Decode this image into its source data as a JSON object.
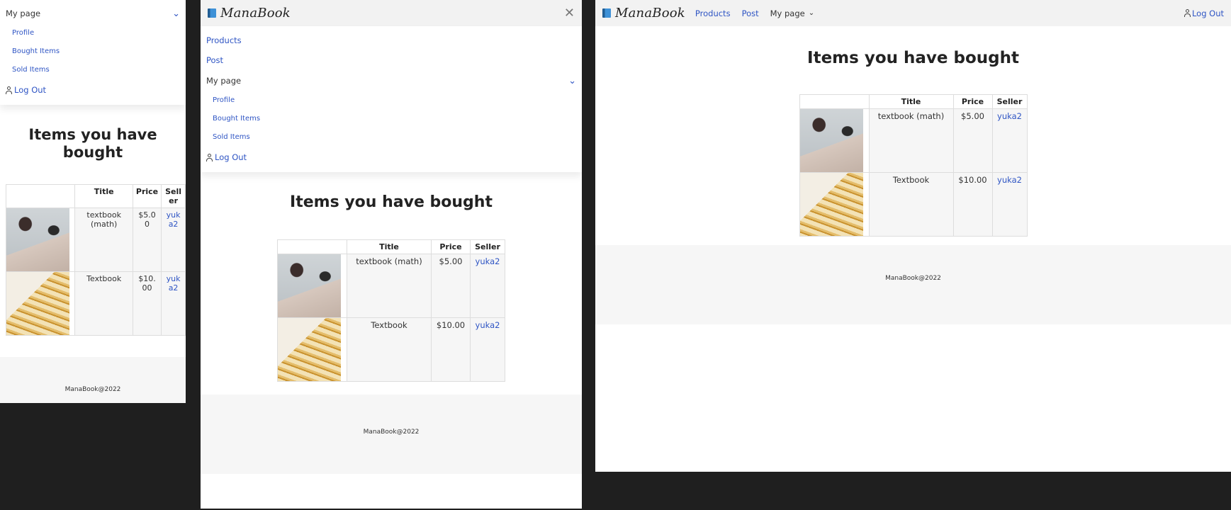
{
  "brand": {
    "name": "ManaBook"
  },
  "nav": {
    "products": "Products",
    "post": "Post",
    "my_page": "My page",
    "sub": {
      "profile": "Profile",
      "bought": "Bought Items",
      "sold": "Sold Items"
    },
    "logout": "Log Out"
  },
  "page": {
    "heading": "Items you have bought",
    "table": {
      "headers": {
        "image": "",
        "title": "Title",
        "price": "Price",
        "seller": "Seller"
      },
      "rows": [
        {
          "image": "glasses-on-book-photo",
          "title": "textbook (math)",
          "price": "$5.00",
          "seller": "yuka2"
        },
        {
          "image": "open-book-pages-photo",
          "title": "Textbook",
          "price": "$10.00",
          "seller": "yuka2"
        }
      ]
    }
  },
  "footer": {
    "text": "ManaBook@2022"
  },
  "icons": {
    "brand": "book-icon",
    "close": "close-icon",
    "expand": "chevron-down-icon",
    "user": "user-icon"
  },
  "colors": {
    "link": "#2f55c4",
    "navbar": "#f2f2f2",
    "footer": "#f6f6f6",
    "backdrop": "#1f1f1f"
  }
}
